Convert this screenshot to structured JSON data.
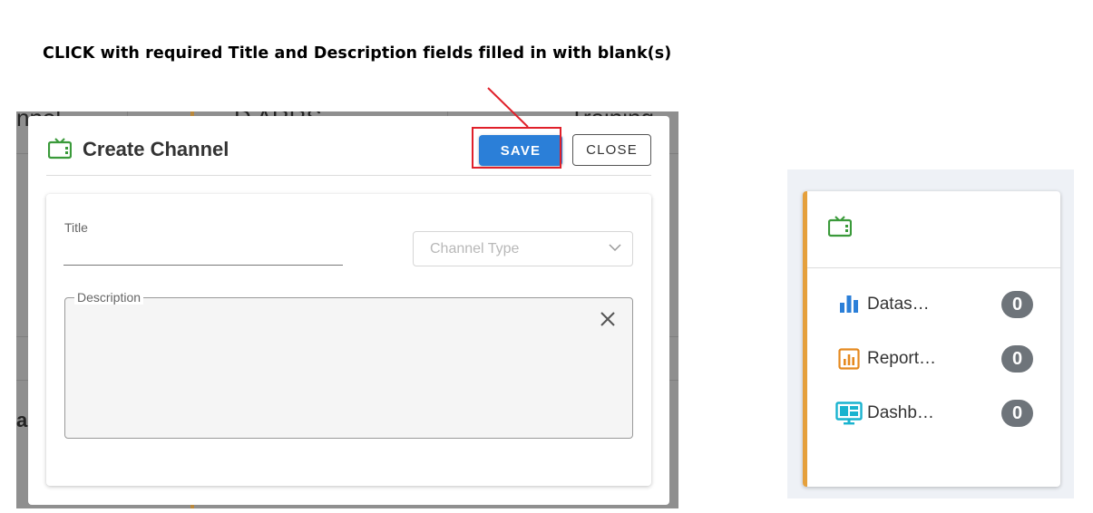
{
  "caption": "CLICK with required Title and Description fields filled in with blank(s)",
  "backdrop": {
    "text_1": "nnel",
    "text_2": "D ARRS",
    "text_3": "Training",
    "text_4": "a"
  },
  "modal": {
    "title": "Create Channel",
    "save_label": "SAVE",
    "close_label": "CLOSE",
    "title_label": "Title",
    "title_value": "",
    "channel_type_placeholder": "Channel Type",
    "description_label": "Description",
    "description_value": ""
  },
  "card": {
    "stats": [
      {
        "label": "Datas…",
        "count": "0",
        "icon": "bar-chart-icon",
        "color": "#2b7fd8"
      },
      {
        "label": "Report…",
        "count": "0",
        "icon": "report-icon",
        "color": "#e5891f"
      },
      {
        "label": "Dashb…",
        "count": "0",
        "icon": "dashboard-icon",
        "color": "#19b3cf"
      }
    ]
  },
  "colors": {
    "primary": "#2b7fd8",
    "highlight": "#e0202a",
    "tv_icon": "#3a9a3a",
    "accent": "#e5a03c"
  }
}
